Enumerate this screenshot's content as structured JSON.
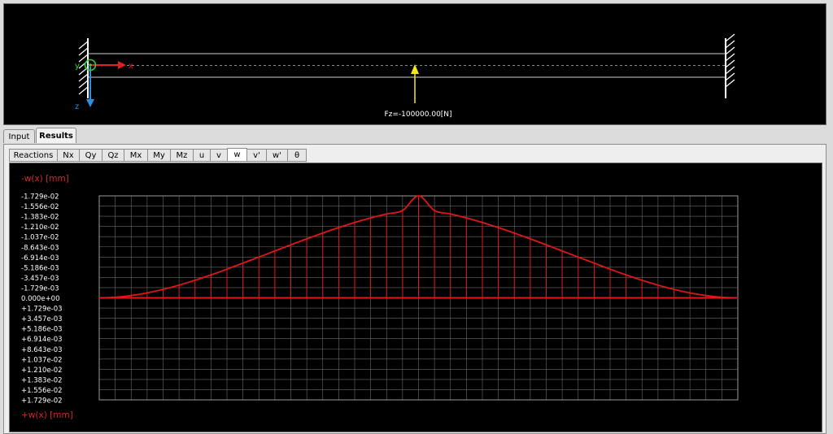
{
  "beam_view": {
    "load_label": "Fz=-100000.00[N]",
    "axis_x_label": "x",
    "axis_y_label": "y",
    "axis_z_label": "z"
  },
  "main_tabs": [
    {
      "label": "Input",
      "active": false
    },
    {
      "label": "Results",
      "active": true
    }
  ],
  "sub_tabs": [
    {
      "label": "Reactions",
      "active": false
    },
    {
      "label": "Nx",
      "active": false
    },
    {
      "label": "Qy",
      "active": false
    },
    {
      "label": "Qz",
      "active": false
    },
    {
      "label": "Mx",
      "active": false
    },
    {
      "label": "My",
      "active": false
    },
    {
      "label": "Mz",
      "active": false
    },
    {
      "label": "u",
      "active": false
    },
    {
      "label": "v",
      "active": false
    },
    {
      "label": "w",
      "active": true
    },
    {
      "label": "v'",
      "active": false
    },
    {
      "label": "w'",
      "active": false
    },
    {
      "label": "θ",
      "active": false
    }
  ],
  "plot": {
    "top_label": "-w(x)  [mm]",
    "bottom_label": "+w(x)  [mm]"
  },
  "colors": {
    "curve": "#e01818",
    "grid": "#6a6a6a",
    "label_red": "#d42828",
    "tick_text": "#ffffff",
    "load_arrow": "#f2e81c",
    "axis_x": "#e02020",
    "axis_z": "#2d8fe0",
    "origin": "#2ed22e"
  },
  "chart_data": {
    "type": "area",
    "y_tick_labels": [
      "-1.729e-02",
      "-1.556e-02",
      "-1.383e-02",
      "-1.210e-02",
      "-1.037e-02",
      "-8.643e-03",
      "-6.914e-03",
      "-5.186e-03",
      "-3.457e-03",
      "-1.729e-03",
      "0.000e+00",
      "+1.729e-03",
      "+3.457e-03",
      "+5.186e-03",
      "+6.914e-03",
      "+8.643e-03",
      "+1.037e-02",
      "+1.210e-02",
      "+1.383e-02",
      "+1.556e-02",
      "+1.729e-02"
    ],
    "ylim": [
      -0.01729,
      0.01729
    ],
    "xlim": [
      0,
      1
    ],
    "grid": true,
    "series": [
      {
        "x": [
          0,
          0.025,
          0.05,
          0.075,
          0.1,
          0.125,
          0.15,
          0.175,
          0.2,
          0.225,
          0.25,
          0.275,
          0.3,
          0.325,
          0.35,
          0.375,
          0.4,
          0.425,
          0.45,
          0.475,
          0.5,
          0.525,
          0.55,
          0.575,
          0.6,
          0.625,
          0.65,
          0.675,
          0.7,
          0.725,
          0.75,
          0.775,
          0.8,
          0.825,
          0.85,
          0.875,
          0.9,
          0.925,
          0.95,
          0.975,
          1
        ],
        "values": [
          0,
          -0.000101,
          -0.000389,
          -0.000843,
          -0.001438,
          -0.002161,
          -0.002987,
          -0.003893,
          -0.004869,
          -0.005894,
          -0.006916,
          -0.007954,
          -0.008988,
          -0.010002,
          -0.010983,
          -0.011916,
          -0.012779,
          -0.013556,
          -0.014232,
          -0.014799,
          -0.01729,
          -0.014799,
          -0.014232,
          -0.013556,
          -0.012779,
          -0.011916,
          -0.010983,
          -0.010002,
          -0.008988,
          -0.007954,
          -0.006916,
          -0.005894,
          -0.004869,
          -0.003893,
          -0.002987,
          -0.002161,
          -0.001438,
          -0.000843,
          -0.000389,
          -0.000101,
          0
        ]
      }
    ]
  }
}
